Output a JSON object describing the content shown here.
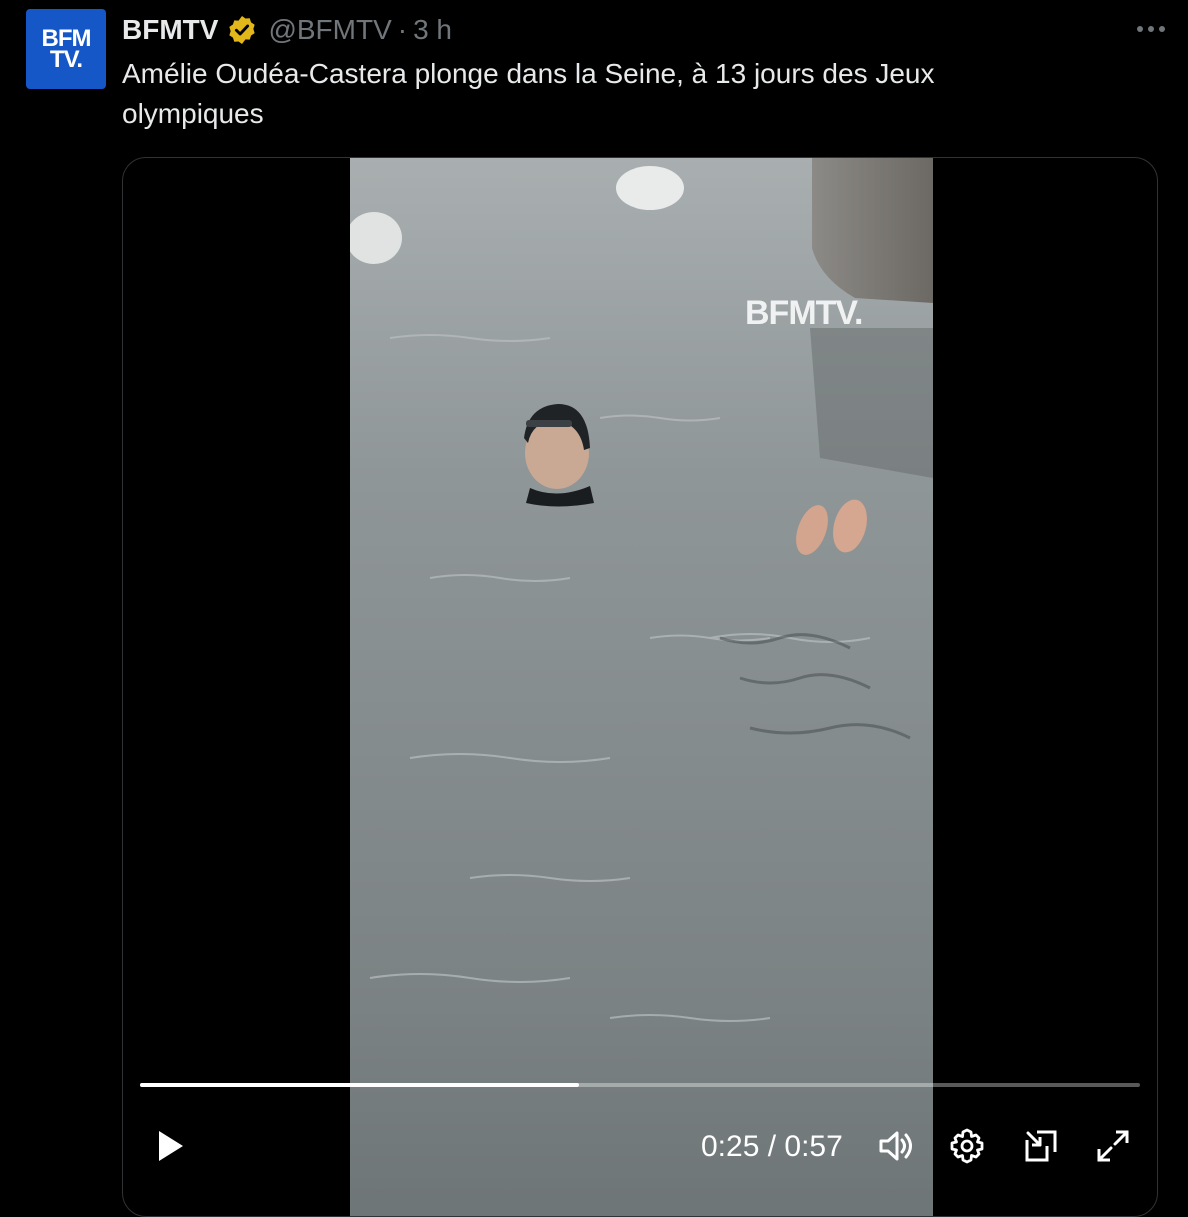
{
  "post": {
    "avatar": {
      "line1": "BFM",
      "line2": "TV.",
      "color": "#1557c7"
    },
    "display_name": "BFMTV",
    "verified_badge": "gold-verified-badge-icon",
    "handle": "@BFMTV",
    "separator": "·",
    "timestamp": "3 h",
    "more_menu": "more-options-icon",
    "text": "Amélie Oudéa-Castera plonge dans la Seine, à 13 jours des Jeux olympiques"
  },
  "video": {
    "watermark": "BFMTV.",
    "current_time": "0:25",
    "duration": "0:57",
    "time_display": "0:25 / 0:57",
    "progress_fraction": 0.4386,
    "controls": {
      "play": "play-icon",
      "volume": "volume-icon",
      "settings": "settings-icon",
      "pip": "picture-in-picture-icon",
      "fullscreen": "fullscreen-icon"
    }
  },
  "colors": {
    "background": "#000000",
    "text": "#e7e9ea",
    "secondary_text": "#71767b",
    "border": "#2f3336",
    "badge_gold": "#e2b719"
  }
}
